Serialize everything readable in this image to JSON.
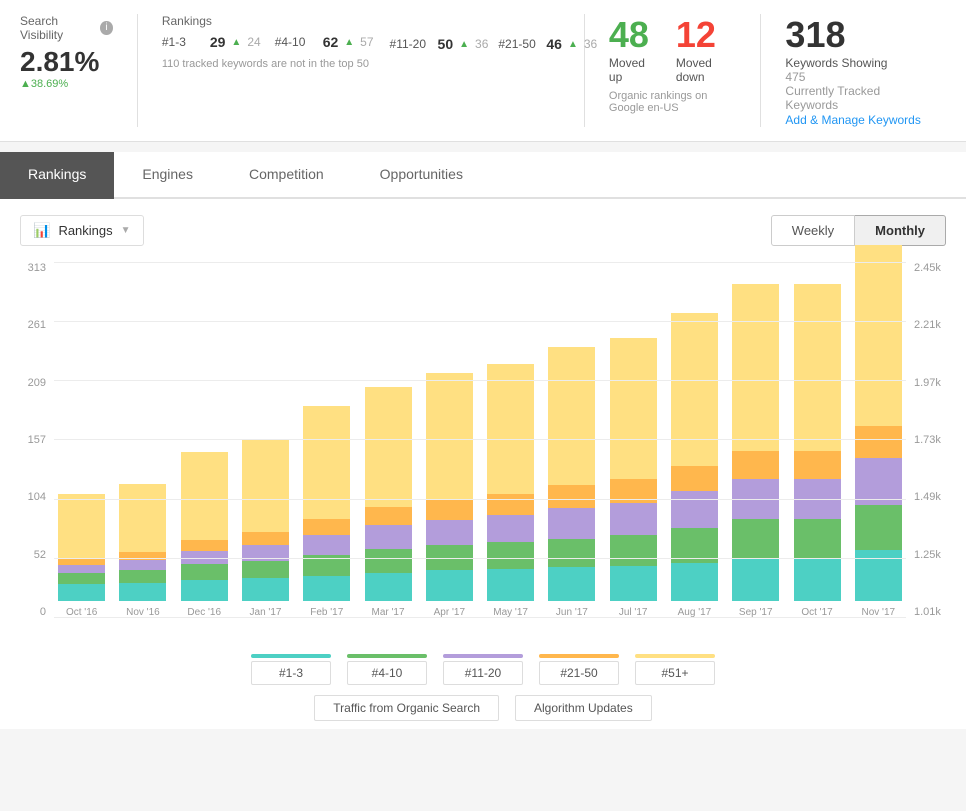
{
  "stats": {
    "search_visibility": {
      "label": "Search Visibility",
      "value": "2.81%",
      "change": "▲38.69%"
    },
    "rankings": {
      "label": "Rankings",
      "rows": [
        {
          "range": "#1-3",
          "count": "29",
          "arrow": "up",
          "change": "24",
          "range2": "#4-10",
          "count2": "62",
          "arrow2": "up",
          "change2": "57"
        },
        {
          "range": "#11-20",
          "count": "50",
          "arrow": "up",
          "change": "36",
          "range2": "#21-50",
          "count2": "46",
          "arrow2": "up",
          "change2": "36"
        }
      ],
      "note": "110 tracked keywords are not in the top 50"
    },
    "moved": {
      "up_value": "48",
      "up_label": "Moved up",
      "down_value": "12",
      "down_label": "Moved down",
      "sub": "Organic rankings on",
      "sub2": "Google en-US"
    },
    "keywords": {
      "main": "318",
      "label": "Keywords Showing",
      "tracked": "475",
      "tracked_label": "Currently Tracked Keywords",
      "link": "Add & Manage Keywords"
    }
  },
  "tabs": [
    "Rankings",
    "Engines",
    "Competition",
    "Opportunities"
  ],
  "active_tab": "Rankings",
  "chart": {
    "dropdown_label": "Rankings",
    "weekly_label": "Weekly",
    "monthly_label": "Monthly",
    "active_period": "Monthly",
    "y_axis_left": [
      "313",
      "261",
      "209",
      "157",
      "104",
      "52",
      "0"
    ],
    "y_axis_right": [
      "2.45k",
      "2.21k",
      "1.97k",
      "1.73k",
      "1.49k",
      "1.25k",
      "1.01k"
    ],
    "bars": [
      {
        "label": "Oct '16",
        "s1": 12,
        "s2": 8,
        "s3": 6,
        "s4": 5,
        "s5": 45
      },
      {
        "label": "Nov '16",
        "s1": 13,
        "s2": 9,
        "s3": 7,
        "s4": 6,
        "s5": 48
      },
      {
        "label": "Dec '16",
        "s1": 15,
        "s2": 11,
        "s3": 9,
        "s4": 8,
        "s5": 62
      },
      {
        "label": "Jan '17",
        "s1": 16,
        "s2": 12,
        "s3": 11,
        "s4": 9,
        "s5": 65
      },
      {
        "label": "Feb '17",
        "s1": 18,
        "s2": 15,
        "s3": 14,
        "s4": 11,
        "s5": 80
      },
      {
        "label": "Mar '17",
        "s1": 20,
        "s2": 17,
        "s3": 17,
        "s4": 13,
        "s5": 85
      },
      {
        "label": "Apr '17",
        "s1": 22,
        "s2": 18,
        "s3": 18,
        "s4": 14,
        "s5": 90
      },
      {
        "label": "May '17",
        "s1": 23,
        "s2": 19,
        "s3": 19,
        "s4": 15,
        "s5": 92
      },
      {
        "label": "Jun '17",
        "s1": 24,
        "s2": 20,
        "s3": 22,
        "s4": 16,
        "s5": 98
      },
      {
        "label": "Jul '17",
        "s1": 25,
        "s2": 22,
        "s3": 23,
        "s4": 17,
        "s5": 100
      },
      {
        "label": "Aug '17",
        "s1": 27,
        "s2": 25,
        "s3": 26,
        "s4": 18,
        "s5": 108
      },
      {
        "label": "Sep '17",
        "s1": 30,
        "s2": 28,
        "s3": 28,
        "s4": 20,
        "s5": 118
      },
      {
        "label": "Oct '17",
        "s1": 30,
        "s2": 28,
        "s3": 28,
        "s4": 20,
        "s5": 118
      },
      {
        "label": "Nov '17",
        "s1": 36,
        "s2": 32,
        "s3": 33,
        "s4": 23,
        "s5": 128
      }
    ],
    "colors": {
      "s1": "#4dd0c4",
      "s2": "#6abf69",
      "s3": "#b39ddb",
      "s4": "#ffb74d",
      "s5": "#ffe082"
    },
    "legend": [
      {
        "color": "#4dd0c4",
        "label": "#1-3"
      },
      {
        "color": "#6abf69",
        "label": "#4-10"
      },
      {
        "color": "#b39ddb",
        "label": "#11-20"
      },
      {
        "color": "#ffb74d",
        "label": "#21-50"
      },
      {
        "color": "#ffe082",
        "label": "#51+"
      }
    ],
    "legend2": [
      {
        "label": "Traffic from Organic Search"
      },
      {
        "label": "Algorithm Updates"
      }
    ]
  }
}
